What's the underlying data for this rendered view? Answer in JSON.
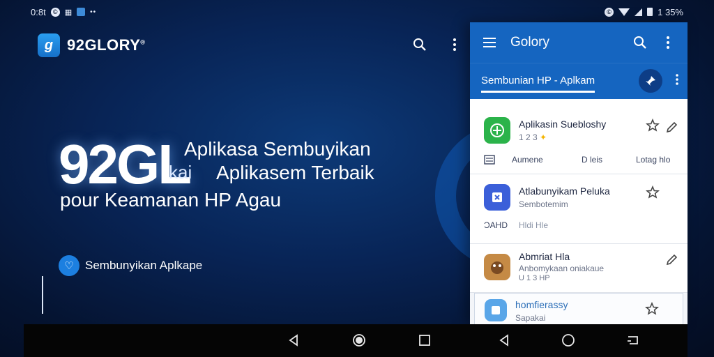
{
  "status_bar": {
    "time": "0:8t",
    "battery": "1 35%"
  },
  "left": {
    "brand": "92GLORY",
    "brand_mark": "®",
    "hero_big": "92GL",
    "hero_kai": "kai",
    "hero_line1": "Aplikasa Sembuyikan",
    "hero_line2": "Aplikasem Terbaik",
    "hero_line3": "pour Keamanan HP Agau",
    "badge_label": "Sembunyikan Aplkape"
  },
  "phone": {
    "app_title": "Golory",
    "tab_label": "Sembunian HP - Aplkam",
    "rows": [
      {
        "title": "Aplikasin Suebloshy",
        "sub": "1 2 3",
        "meta_left": "Aumene",
        "meta_mid": "D leis",
        "meta_right": "Lotag  hlo"
      },
      {
        "title": "Atlabunyikam Peluka",
        "sub": "Sembotemim",
        "meta_left": "ƆAHD",
        "meta_mid": "Hldi Hle"
      },
      {
        "title": "Abmriat Hla",
        "sub": "Anbomykaan oniakaue",
        "sub2": "U 1 3 HP"
      },
      {
        "title": "homfierassy",
        "sub": "Sapakai"
      }
    ]
  },
  "colors": {
    "accent": "#1565c0",
    "background": "#082456"
  }
}
